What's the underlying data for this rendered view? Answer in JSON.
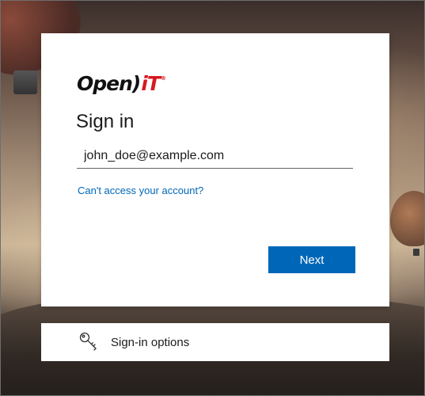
{
  "brand": {
    "logo_text": "Open",
    "logo_paren": ")",
    "logo_i": "i",
    "logo_t": "T",
    "logo_reg": "®",
    "accent_color": "#d71920"
  },
  "signin": {
    "title": "Sign in",
    "email_value": "john_doe@example.com",
    "cant_access_link": "Can't access your account?",
    "next_button": "Next",
    "button_color": "#0067b8"
  },
  "options": {
    "label": "Sign-in options",
    "icon": "key-icon"
  }
}
